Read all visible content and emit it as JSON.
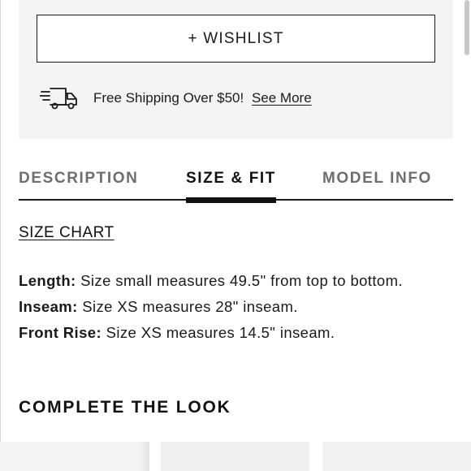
{
  "product_actions": {
    "wishlist_label": "+ WISHLIST"
  },
  "shipping": {
    "icon": "delivery-truck-icon",
    "text": "Free Shipping Over $50! ",
    "link_label": "See More"
  },
  "tabs": [
    {
      "label": "DESCRIPTION",
      "active": false
    },
    {
      "label": "SIZE & FIT",
      "active": true
    },
    {
      "label": "MODEL INFO",
      "active": false
    }
  ],
  "size_fit": {
    "size_chart_label": "SIZE CHART",
    "specs": [
      {
        "key": "Length:",
        "value": " Size small measures 49.5\" from top to bottom."
      },
      {
        "key": "Inseam:",
        "value": " Size XS measures 28\" inseam."
      },
      {
        "key": "Front Rise:",
        "value": " Size XS measures 14.5\" inseam."
      }
    ]
  },
  "complete_the_look": {
    "heading": "COMPLETE THE LOOK",
    "thumbnails": [
      "product-thumbnail-1",
      "product-thumbnail-2",
      "product-thumbnail-3"
    ]
  },
  "colors": {
    "panel_bg": "#f4f4f4",
    "text": "#1a1a1a",
    "inactive_tab": "#6e6e6e"
  }
}
